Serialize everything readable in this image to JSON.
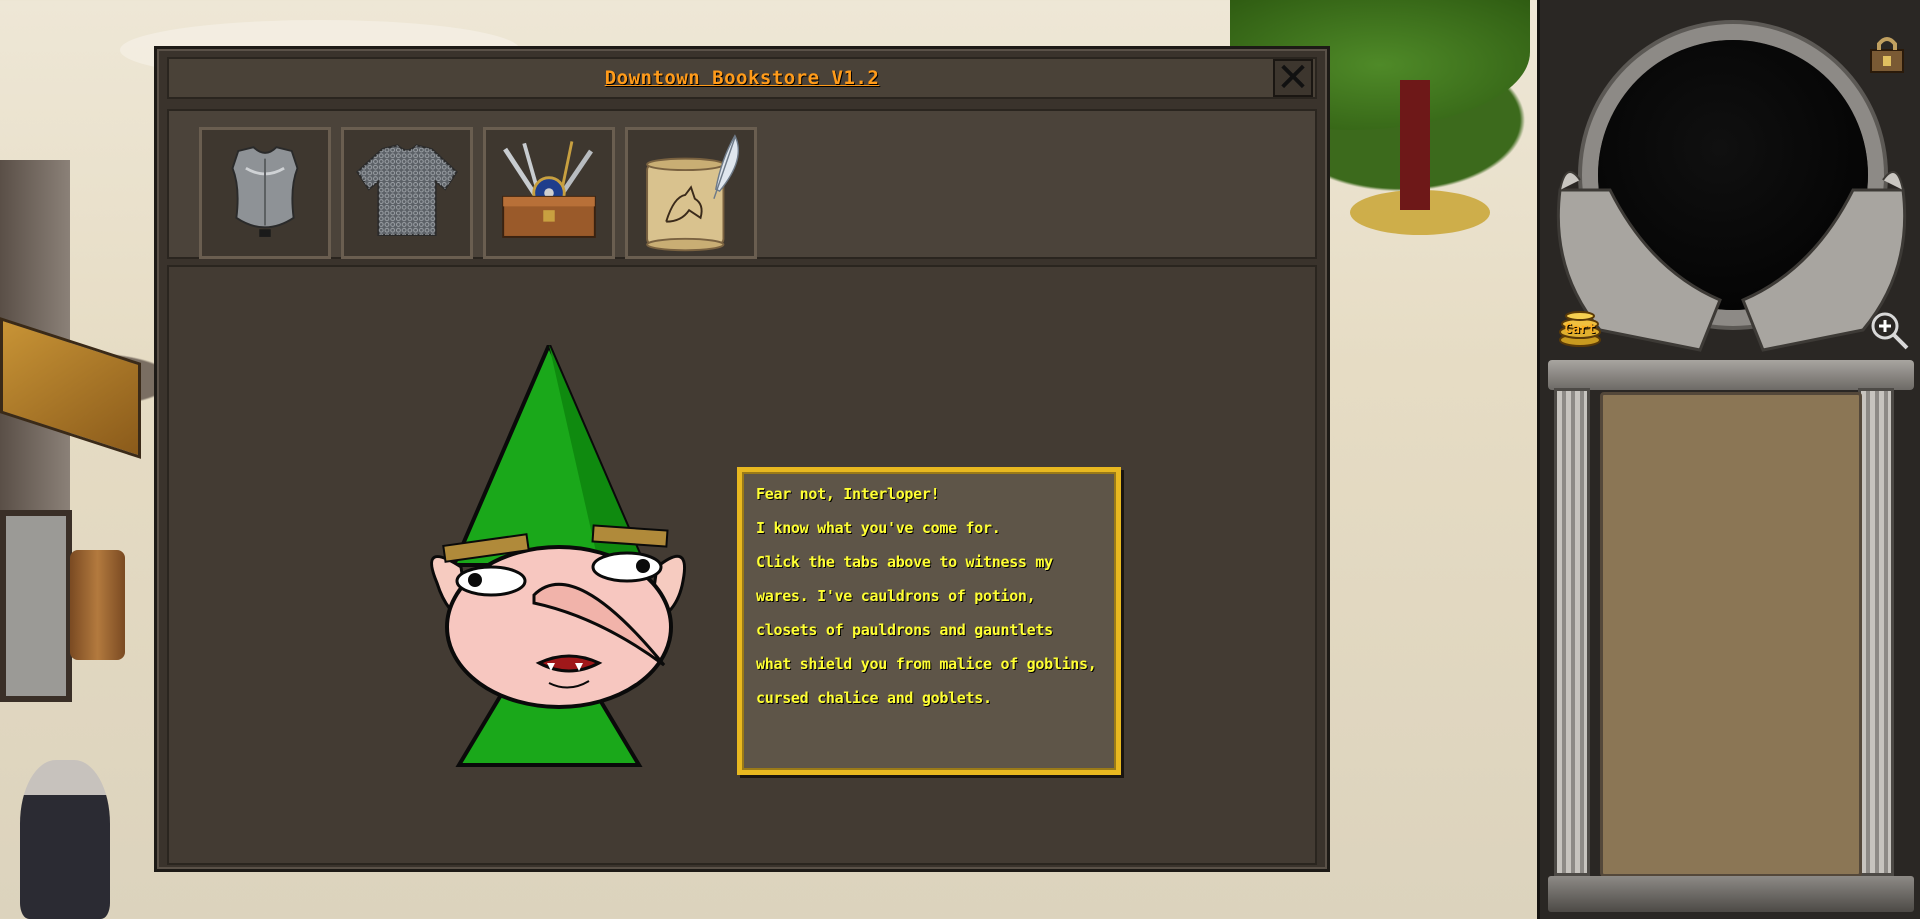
{
  "window": {
    "title": "Downtown Bookstore V1.2",
    "close_symbol": "✕"
  },
  "tabs": [
    {
      "icon": "plate-armor-icon"
    },
    {
      "icon": "chainmail-icon"
    },
    {
      "icon": "weapons-chest-icon"
    },
    {
      "icon": "scroll-quill-icon"
    }
  ],
  "dialogue": {
    "lines": [
      "Fear not, Interloper!",
      "I know what you've come for.",
      "Click the tabs above to witness my",
      "wares. I've cauldrons of potion,",
      "closets of pauldrons and gauntlets",
      "what shield you from malice of goblins,",
      "cursed chalice and goblets."
    ]
  },
  "side_panel": {
    "cart_label": "Cart",
    "icons": [
      "lock-icon",
      "coins-cart-icon",
      "zoom-in-icon"
    ]
  },
  "colors": {
    "title": "#ff9b1a",
    "dialogue_text": "#ffff33",
    "dialogue_border": "#e8b820",
    "window_bg": "#3a332c"
  }
}
